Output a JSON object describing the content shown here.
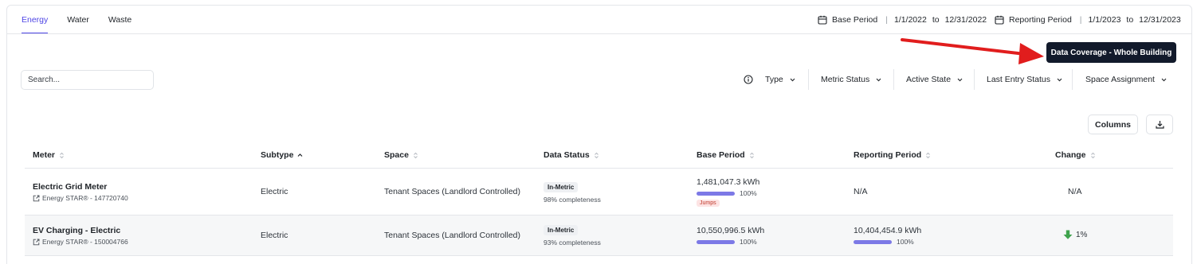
{
  "tabs": [
    {
      "label": "Energy",
      "active": true
    },
    {
      "label": "Water",
      "active": false
    },
    {
      "label": "Waste",
      "active": false
    }
  ],
  "base_period": {
    "label": "Base Period",
    "start": "1/1/2022",
    "to": "to",
    "end": "12/31/2022"
  },
  "reporting_period": {
    "label": "Reporting Period",
    "start": "1/1/2023",
    "to": "to",
    "end": "12/31/2023"
  },
  "coverage_button": "Data Coverage - Whole Building",
  "search": {
    "placeholder": "Search...",
    "value": ""
  },
  "filters": [
    {
      "label": "Type"
    },
    {
      "label": "Metric Status"
    },
    {
      "label": "Active State"
    },
    {
      "label": "Last Entry Status"
    },
    {
      "label": "Space Assignment"
    }
  ],
  "columns_button": "Columns",
  "table": {
    "headers": [
      "Meter",
      "Subtype",
      "Space",
      "Data Status",
      "Base Period",
      "Reporting Period",
      "Change"
    ],
    "rows": [
      {
        "meter": "Electric Grid Meter",
        "meter_source": "Energy STAR® - 147720740",
        "subtype": "Electric",
        "space": "Tenant Spaces (Landlord Controlled)",
        "status_badge": "In-Metric",
        "completeness": "98% completeness",
        "base_value": "1,481,047.3 kWh",
        "base_pct": "100%",
        "base_flag": "Jumps",
        "reporting_value": "N/A",
        "change": "N/A"
      },
      {
        "meter": "EV Charging - Electric",
        "meter_source": "Energy STAR® - 150004766",
        "subtype": "Electric",
        "space": "Tenant Spaces (Landlord Controlled)",
        "status_badge": "In-Metric",
        "completeness": "93% completeness",
        "base_value": "10,550,996.5 kWh",
        "base_pct": "100%",
        "reporting_value": "10,404,454.9 kWh",
        "reporting_pct": "100%",
        "change": "1%"
      }
    ]
  },
  "colors": {
    "accent": "#4f46e5",
    "progress": "#7c79e6",
    "dark_button": "#121a2b",
    "annotation_arrow": "#e11d1d",
    "change_down": "#3fa34d",
    "jumps_bg": "#fde4e4"
  },
  "icons": [
    "calendar-icon",
    "info-icon",
    "chevron-down-icon",
    "sort-icon",
    "external-link-icon",
    "download-icon",
    "arrow-down-icon"
  ]
}
